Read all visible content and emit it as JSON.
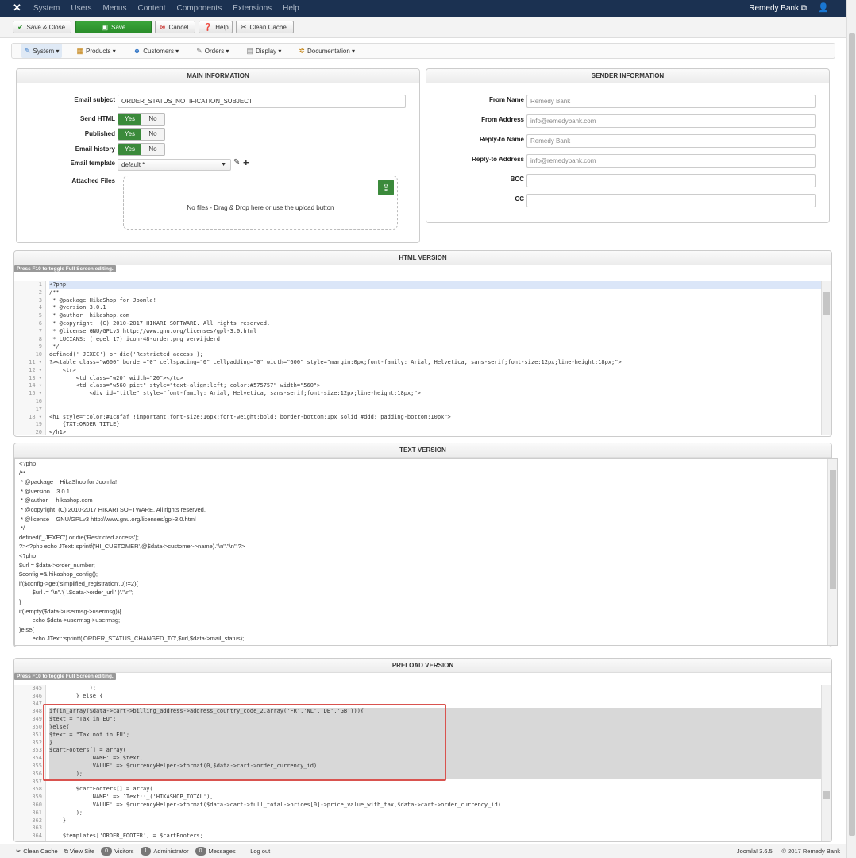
{
  "topbar": {
    "menu": [
      "System",
      "Users",
      "Menus",
      "Content",
      "Components",
      "Extensions",
      "Help"
    ],
    "site_name": "Remedy Bank ⧉",
    "user_icon": "user-icon"
  },
  "toolbar": {
    "save_close": "Save & Close",
    "save": "Save",
    "cancel": "Cancel",
    "help": "Help",
    "clean_cache": "Clean Cache"
  },
  "submenu": [
    {
      "label": "System ▾",
      "icon": "wrench-icon"
    },
    {
      "label": "Products ▾",
      "icon": "box-icon"
    },
    {
      "label": "Customers ▾",
      "icon": "users-icon"
    },
    {
      "label": "Orders ▾",
      "icon": "cart-icon"
    },
    {
      "label": "Display ▾",
      "icon": "display-icon"
    },
    {
      "label": "Documentation ▾",
      "icon": "doc-icon"
    }
  ],
  "main_info": {
    "title": "MAIN INFORMATION",
    "subject_label": "Email subject",
    "subject_value": "ORDER_STATUS_NOTIFICATION_SUBJECT",
    "send_html_label": "Send HTML",
    "published_label": "Published",
    "history_label": "Email history",
    "yes": "Yes",
    "no": "No",
    "template_label": "Email template",
    "template_value": "default *",
    "attached_label": "Attached Files",
    "dropzone_text": "No files - Drag & Drop here or use the upload button"
  },
  "sender_info": {
    "title": "SENDER INFORMATION",
    "from_name_label": "From Name",
    "from_name_value": "Remedy Bank",
    "from_address_label": "From Address",
    "from_address_value": "info@remedybank.com",
    "reply_name_label": "Reply-to Name",
    "reply_name_value": "Remedy Bank",
    "reply_address_label": "Reply-to Address",
    "reply_address_value": "info@remedybank.com",
    "bcc_label": "BCC",
    "cc_label": "CC"
  },
  "html_version": {
    "title": "HTML VERSION",
    "f11_note": "Press F10 to toggle Full Screen editing.",
    "line_numbers": [
      "1",
      "2",
      "3",
      "4",
      "5",
      "6",
      "7",
      "8",
      "9",
      "10",
      "11 ▾",
      "12 ▾",
      "13 ▾",
      "14 ▾",
      "15 ▾",
      "16",
      "17",
      "18 ▾",
      "19",
      "20"
    ],
    "lines": [
      "<?php",
      "/**",
      " * @package HikaShop for Joomla!",
      " * @version 3.0.1",
      " * @author  hikashop.com",
      " * @copyright  (C) 2010-2017 HIKARI SOFTWARE. All rights reserved.",
      " * @license GNU/GPLv3 http://www.gnu.org/licenses/gpl-3.0.html",
      " * LUCIANS: (regel 17) icon-48-order.png verwijderd",
      " */",
      "defined('_JEXEC') or die('Restricted access');",
      "?><table class=\"w600\" border=\"0\" cellspacing=\"0\" cellpadding=\"0\" width=\"600\" style=\"margin:0px;font-family: Arial, Helvetica, sans-serif;font-size:12px;line-height:18px;\">",
      "    <tr>",
      "        <td class=\"w20\" width=\"20\"></td>",
      "        <td class=\"w560 pict\" style=\"text-align:left; color:#575757\" width=\"560\">",
      "            <div id=\"title\" style=\"font-family: Arial, Helvetica, sans-serif;font-size:12px;line-height:18px;\">",
      "",
      "",
      "<h1 style=\"color:#1c8faf !important;font-size:16px;font-weight:bold; border-bottom:1px solid #ddd; padding-bottom:10px\">",
      "    {TXT:ORDER_TITLE}",
      "</h1>"
    ]
  },
  "text_version": {
    "title": "TEXT VERSION",
    "lines": [
      "<?php",
      "/**",
      " * @package    HikaShop for Joomla!",
      " * @version    3.0.1",
      " * @author     hikashop.com",
      " * @copyright  (C) 2010-2017 HIKARI SOFTWARE. All rights reserved.",
      " * @license    GNU/GPLv3 http://www.gnu.org/licenses/gpl-3.0.html",
      " */",
      "defined('_JEXEC') or die('Restricted access');",
      "?><?php echo JText::sprintf('HI_CUSTOMER',@$data->customer->name).\"\\n\".\"\\n\";?>",
      "<?php",
      "$url = $data->order_number;",
      "$config =& hikashop_config();",
      "if($config->get('simplified_registration',0)!=2){",
      "        $url .= \"\\n\".'( '.$data->order_url.' )'.\"\\n\";",
      "}",
      "if(!empty($data->usermsg->usermsg)){",
      "        echo $data->usermsg->usermsg;",
      "}else{",
      "        echo JText::sprintf('ORDER_STATUS_CHANGED_TO',$url,$data->mail_status);"
    ]
  },
  "preload_version": {
    "title": "PRELOAD VERSION",
    "f11_note": "Press F10 to toggle Full Screen editing.",
    "line_numbers": [
      "345",
      "346",
      "347",
      "348",
      "349",
      "350",
      "351",
      "352",
      "353",
      "354",
      "355",
      "356",
      "357",
      "358",
      "359",
      "360",
      "361",
      "362",
      "363",
      "364"
    ],
    "lines": [
      "            );",
      "        } else {",
      "",
      "if(in_array($data->cart->billing_address->address_country_code_2,array('FR','NL','DE','GB'))){",
      "$text = \"Tax in EU\";",
      "}else{",
      "$text = \"Tax not in EU\";",
      "}",
      "$cartFooters[] = array(",
      "            'NAME' => $text,",
      "            'VALUE' => $currencyHelper->format(0,$data->cart->order_currency_id)",
      "        );",
      "",
      "        $cartFooters[] = array(",
      "            'NAME' => JText::_('HIKASHOP_TOTAL'),",
      "            'VALUE' => $currencyHelper->format($data->cart->full_total->prices[0]->price_value_with_tax,$data->cart->order_currency_id)",
      "        );",
      "    }",
      "",
      "    $templates['ORDER_FOOTER'] = $cartFooters;"
    ]
  },
  "statusbar": {
    "clean_cache": "Clean Cache",
    "view_site": "View Site",
    "visitors_count": "0",
    "visitors": "Visitors",
    "admin_count": "1",
    "admin": "Administrator",
    "messages_count": "0",
    "messages": "Messages",
    "logout": "Log out",
    "version": "Joomla! 3.6.5 — © 2017 Remedy Bank"
  }
}
